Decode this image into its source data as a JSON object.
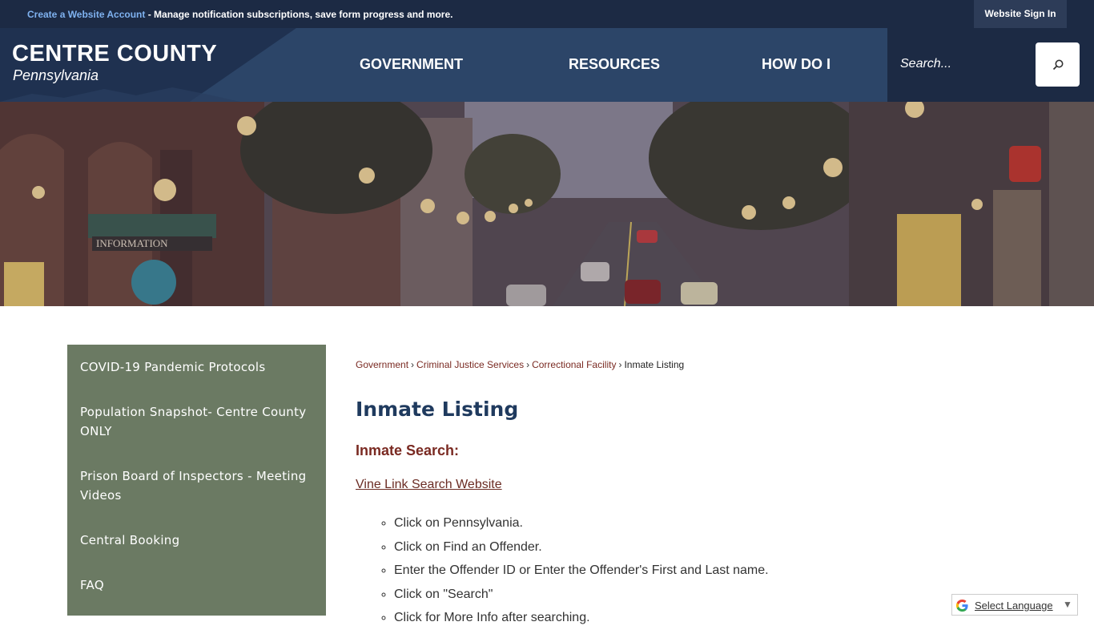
{
  "topbar": {
    "create_account": "Create a Website Account",
    "promo_text": " - Manage notification subscriptions, save form progress and more.",
    "sign_in": "Website Sign In"
  },
  "header": {
    "logo_title": "CENTRE COUNTY",
    "logo_subtitle": "Pennsylvania",
    "nav": [
      "GOVERNMENT",
      "RESOURCES",
      "HOW DO I"
    ],
    "search_placeholder": "Search..."
  },
  "sidebar": {
    "items": [
      "COVID-19 Pandemic Protocols",
      "Population Snapshot- Centre County ONLY",
      "Prison Board of Inspectors - Meeting Videos",
      "Central Booking",
      "FAQ"
    ]
  },
  "content": {
    "breadcrumb": [
      "Government",
      "Criminal Justice Services",
      "Correctional Facility",
      "Inmate Listing"
    ],
    "title": "Inmate Listing",
    "subtitle": "Inmate Search:",
    "link": "Vine Link Search Website",
    "steps": [
      "Click on Pennsylvania.",
      "Click on Find an Offender.",
      "Enter the Offender ID or Enter the Offender's First and Last name.",
      "Click on \"Search\"",
      "Click for More Info after searching."
    ]
  },
  "translate": {
    "label": "Select Language"
  },
  "colors": {
    "header": "#2c4568",
    "topbar": "#1c2a44",
    "sidebar": "#6b7a63",
    "title": "#1f3a5e",
    "accent": "#7a2a22"
  }
}
